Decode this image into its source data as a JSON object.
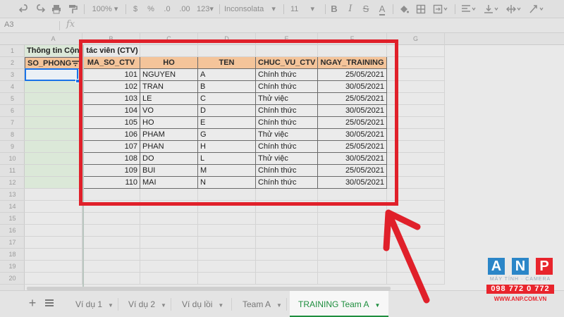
{
  "toolbar": {
    "zoom": "100%",
    "percent": "%",
    "decimal_less": ".0",
    "decimal_more": ".00",
    "format_number": "123",
    "font": "Inconsolata",
    "font_size": "11",
    "bold": "B",
    "italic": "I",
    "text_color": "A"
  },
  "formula_bar": {
    "cell_ref": "A3",
    "fx": "fx"
  },
  "columns": [
    "A",
    "B",
    "C",
    "D",
    "E",
    "F",
    "G"
  ],
  "rows": [
    "1",
    "2",
    "3",
    "4",
    "5",
    "6",
    "7",
    "8",
    "9",
    "10",
    "11",
    "12",
    "13",
    "14",
    "15",
    "16",
    "17",
    "18",
    "19",
    "20"
  ],
  "sheet": {
    "title": "Thông tin Cộng tác viên (CTV)",
    "headers": [
      "SO_PHONG",
      "MA_SO_CTV",
      "HO",
      "TEN",
      "CHUC_VU_CTV",
      "NGAY_TRAINING"
    ],
    "records": [
      {
        "ma": "101",
        "ho": "NGUYEN",
        "ten": "A",
        "chuc_vu": "Chính thức",
        "ngay": "25/05/2021"
      },
      {
        "ma": "102",
        "ho": "TRAN",
        "ten": "B",
        "chuc_vu": "Chính thức",
        "ngay": "30/05/2021"
      },
      {
        "ma": "103",
        "ho": "LE",
        "ten": "C",
        "chuc_vu": "Thử việc",
        "ngay": "25/05/2021"
      },
      {
        "ma": "104",
        "ho": "VO",
        "ten": "D",
        "chuc_vu": "Chính thức",
        "ngay": "30/05/2021"
      },
      {
        "ma": "105",
        "ho": "HO",
        "ten": "E",
        "chuc_vu": "Chính thức",
        "ngay": "25/05/2021"
      },
      {
        "ma": "106",
        "ho": "PHAM",
        "ten": "G",
        "chuc_vu": "Thử việc",
        "ngay": "30/05/2021"
      },
      {
        "ma": "107",
        "ho": "PHAN",
        "ten": "H",
        "chuc_vu": "Chính thức",
        "ngay": "25/05/2021"
      },
      {
        "ma": "108",
        "ho": "DO",
        "ten": "L",
        "chuc_vu": "Thử việc",
        "ngay": "30/05/2021"
      },
      {
        "ma": "109",
        "ho": "BUI",
        "ten": "M",
        "chuc_vu": "Chính thức",
        "ngay": "25/05/2021"
      },
      {
        "ma": "110",
        "ho": "MAI",
        "ten": "N",
        "chuc_vu": "Chính thức",
        "ngay": "30/05/2021"
      }
    ]
  },
  "tabs": [
    {
      "label": "Ví dụ 1",
      "active": false
    },
    {
      "label": "Ví dụ 2",
      "active": false
    },
    {
      "label": "Ví dụ lồi",
      "active": false
    },
    {
      "label": "Team A",
      "active": false
    },
    {
      "label": "TRAINING Team A",
      "active": true
    }
  ],
  "logo": {
    "letters": [
      "A",
      "N",
      "P"
    ],
    "subtitle": "MÁY TÍNH · CAMERA",
    "phone": "098 772 0 772",
    "website": "WWW.ANP.COM.VN"
  },
  "colors": {
    "header_fill": "#f4c49a",
    "annotation": "#e0202a",
    "active_tab": "#1e8e3e",
    "selection": "#1a73e8",
    "logo_blue": "#2b86c8",
    "logo_red": "#e8242c"
  }
}
